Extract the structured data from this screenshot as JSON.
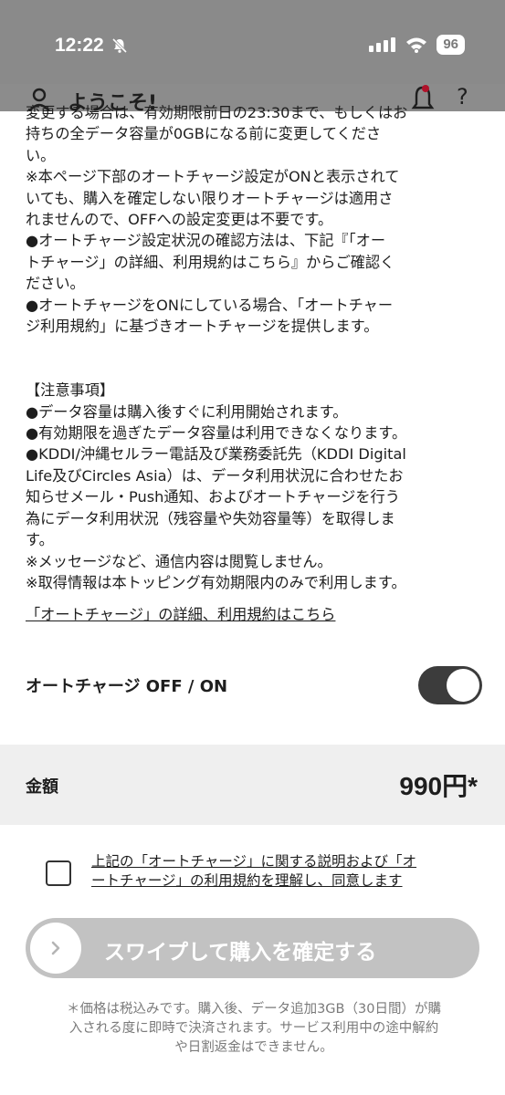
{
  "status_bar": {
    "time": "12:22",
    "battery": "96"
  },
  "header": {
    "title": "ようこそ!",
    "help": "?"
  },
  "body": {
    "lines": [
      "変更する場合は、有効期限前日の23:30まで、もしくはお",
      "持ちの全データ容量が0GBになる前に変更してくださ",
      "い。",
      "※本ページ下部のオートチャージ設定がONと表示されて",
      "いても、購入を確定しない限りオートチャージは適用さ",
      "れませんので、OFFへの設定変更は不要です。",
      "●オートチャージ設定状況の確認方法は、下記『「オー",
      "トチャージ」の詳細、利用規約はこちら』からご確認く",
      "ださい。",
      "●オートチャージをONにしている場合、「オートチャー",
      "ジ利用規約」に基づきオートチャージを提供します。"
    ],
    "notes_lines": [
      "【注意事項】",
      "●データ容量は購入後すぐに利用開始されます。",
      "●有効期限を過ぎたデータ容量は利用できなくなります。",
      "●KDDI/沖縄セルラー電話及び業務委託先（KDDI Digital",
      "Life及びCircles Asia）は、データ利用状況に合わせたお",
      "知らせメール・Push通知、およびオートチャージを行う",
      "為にデータ利用状況（残容量や失効容量等）を取得しま",
      "す。",
      "※メッセージなど、通信内容は閲覧しません。",
      "※取得情報は本トッピング有効期限内のみで利用します。"
    ]
  },
  "terms_link": "「オートチャージ」の詳細、利用規約はこちら",
  "auto_charge": {
    "label": "オートチャージ OFF / ON",
    "enabled": true
  },
  "price": {
    "label": "金額",
    "value": "990円*"
  },
  "agreement": {
    "line1": "上記の「オートチャージ」に関する説明および「オ",
    "line2": "ートチャージ」の利用規約を理解し、同意します",
    "checked": false
  },
  "swipe": {
    "label": "スワイプして購入を確定する"
  },
  "footnote": {
    "line1": "＊価格は税込みです。購入後、データ追加3GB（30日間）が購",
    "line2": "入される度に即時で決済されます。サービス利用中の途中解約",
    "line3": "や日割返金はできません。"
  },
  "colors": {
    "status_bar": "#8a8a8a",
    "toggle_on": "#3c3c3c",
    "price_band": "#efefef",
    "swipe_disabled": "#c2c2c2",
    "notification_dot": "#b0122a"
  }
}
